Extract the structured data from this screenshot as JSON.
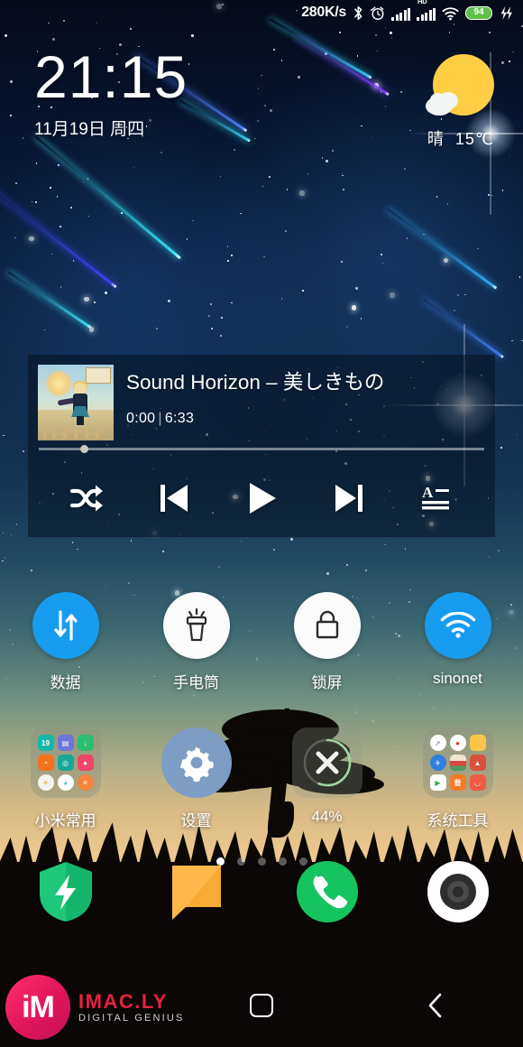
{
  "statusbar": {
    "network_speed": "280K/s",
    "bluetooth_icon": "bluetooth-icon",
    "alarm_icon": "alarm-icon",
    "signal1_icon": "signal-bars-icon",
    "signal2_icon": "signal-bars-hd-icon",
    "hd_label": "HD",
    "wifi_icon": "wifi-icon",
    "battery_level": "94",
    "charging_icon": "charging-bolt-icon"
  },
  "clock_widget": {
    "time": "21:15",
    "date": "11月19日 周四"
  },
  "weather_widget": {
    "icon": "sun-behind-cloud-icon",
    "condition": "晴",
    "temperature": "15℃"
  },
  "music_widget": {
    "album_art": "album-cover-art",
    "title": "Sound Horizon – 美しきもの",
    "elapsed": "0:00",
    "separator": "|",
    "duration": "6:33",
    "progress_percent": 8,
    "controls": [
      {
        "name": "shuffle-button",
        "icon": "shuffle-icon",
        "label": "随机播放"
      },
      {
        "name": "previous-button",
        "icon": "skip-previous-icon",
        "label": "上一首"
      },
      {
        "name": "play-button",
        "icon": "play-icon",
        "label": "播放"
      },
      {
        "name": "next-button",
        "icon": "skip-next-icon",
        "label": "下一首"
      },
      {
        "name": "lyrics-button",
        "icon": "lyrics-icon",
        "label": "歌词"
      }
    ]
  },
  "toggles": [
    {
      "label": "数据",
      "icon": "mobile-data-icon",
      "state": "on",
      "color": "#179cf0"
    },
    {
      "label": "手电筒",
      "icon": "flashlight-icon",
      "state": "off",
      "color": "#fbfbfb"
    },
    {
      "label": "锁屏",
      "icon": "lock-icon",
      "state": "off",
      "color": "#fbfbfb"
    },
    {
      "label": "sinonet",
      "icon": "wifi-icon",
      "state": "on",
      "color": "#179cf0"
    }
  ],
  "app_row": [
    {
      "label": "小米常用",
      "type": "folder",
      "icon": "folder-icon"
    },
    {
      "label": "设置",
      "type": "app",
      "icon": "settings-gear-icon"
    },
    {
      "label": "44%",
      "type": "widget",
      "icon": "memory-cleaner-icon",
      "percent": 44
    },
    {
      "label": "系统工具",
      "type": "folder",
      "icon": "folder-icon"
    }
  ],
  "page_indicator": {
    "total": 5,
    "active": 1
  },
  "dock": [
    {
      "label": "安全中心",
      "icon": "security-shield-icon",
      "color": "#1ec77a"
    },
    {
      "label": "短信",
      "icon": "message-bubble-icon",
      "color": "#fcb84b"
    },
    {
      "label": "电话",
      "icon": "phone-icon",
      "color": "#16c45f"
    },
    {
      "label": "相机",
      "icon": "camera-icon",
      "color": "#ffffff"
    }
  ],
  "navbar": [
    {
      "name": "menu-button",
      "icon": "menu-icon",
      "label": ""
    },
    {
      "name": "home-button",
      "icon": "home-square-icon",
      "label": ""
    },
    {
      "name": "back-button",
      "icon": "back-chevron-icon",
      "label": ""
    }
  ],
  "watermark": {
    "logo_text": "iM",
    "brand": "IMAC.LY",
    "tagline": "DIGITAL GENIUS"
  }
}
